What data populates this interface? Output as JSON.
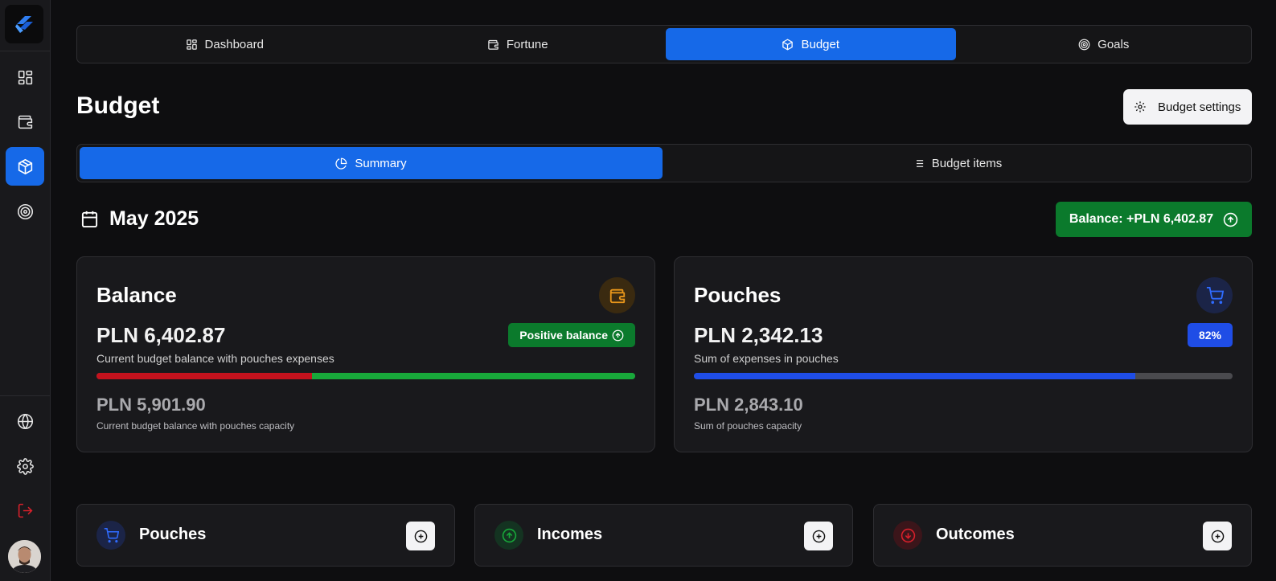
{
  "sidebar": {
    "items": [
      {
        "icon": "dashboard-icon"
      },
      {
        "icon": "wallet-icon"
      },
      {
        "icon": "box-icon",
        "active": true
      },
      {
        "icon": "target-icon"
      }
    ],
    "bottom": [
      {
        "icon": "globe-icon"
      },
      {
        "icon": "gear-icon"
      },
      {
        "icon": "logout-icon"
      }
    ]
  },
  "topnav": {
    "tabs": [
      {
        "label": "Dashboard",
        "icon": "dashboard-icon"
      },
      {
        "label": "Fortune",
        "icon": "wallet-icon"
      },
      {
        "label": "Budget",
        "icon": "box-icon",
        "active": true
      },
      {
        "label": "Goals",
        "icon": "target-icon"
      }
    ]
  },
  "page": {
    "title": "Budget",
    "settings_label": "Budget settings"
  },
  "subnav": {
    "tabs": [
      {
        "label": "Summary",
        "icon": "pie-chart-icon",
        "active": true
      },
      {
        "label": "Budget items",
        "icon": "list-icon"
      }
    ]
  },
  "period": {
    "label": "May 2025",
    "balance_label": "Balance: +PLN 6,402.87"
  },
  "balance_card": {
    "title": "Balance",
    "amount": "PLN 6,402.87",
    "badge": "Positive balance",
    "description": "Current budget balance with pouches expenses",
    "amount2": "PLN 5,901.90",
    "description2": "Current budget balance with pouches capacity",
    "bar_red_fraction": 0.4,
    "colors": {
      "red": "#c4121d",
      "green": "#18a83a",
      "badge": "#0b7a2c",
      "icon_bg": "#3a2a10",
      "icon": "#e8961a"
    }
  },
  "pouches_card": {
    "title": "Pouches",
    "amount": "PLN 2,342.13",
    "badge": "82%",
    "description": "Sum of expenses in pouches",
    "amount2": "PLN 2,843.10",
    "description2": "Sum of pouches capacity",
    "bar_fill_fraction": 0.82,
    "colors": {
      "fill": "#1f4de6",
      "track": "#4a4a4e",
      "badge": "#1f4de6",
      "icon_bg": "#1b2447",
      "icon": "#2f6bff"
    }
  },
  "sections": [
    {
      "title": "Pouches",
      "icon": "cart-icon",
      "icon_color": "#2f6bff",
      "icon_bg": "#1b2447"
    },
    {
      "title": "Incomes",
      "icon": "arrow-up-circle-icon",
      "icon_color": "#18a83a",
      "icon_bg": "#143321"
    },
    {
      "title": "Outcomes",
      "icon": "arrow-down-circle-icon",
      "icon_color": "#d8202b",
      "icon_bg": "#3b151a"
    }
  ]
}
